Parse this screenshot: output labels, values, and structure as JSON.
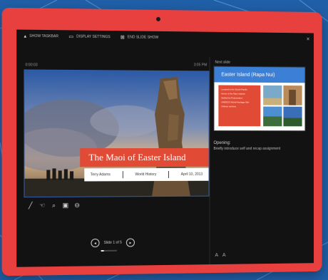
{
  "toolbar": {
    "items": [
      {
        "label": "SHOW TASKBAR",
        "icon": "taskbar-icon"
      },
      {
        "label": "DISPLAY SETTINGS",
        "icon": "display-icon"
      },
      {
        "label": "END SLIDE SHOW",
        "icon": "end-show-icon"
      }
    ]
  },
  "presenter": {
    "timer": "0:00:03",
    "clock": "3:05 PM",
    "next_label": "Next slide"
  },
  "current_slide": {
    "title": "The Maoi of Easter Island",
    "presenter": "Terry Adams",
    "course": "World History",
    "date": "April 10, 2013"
  },
  "tools": [
    "pen-icon",
    "pointer-icon",
    "zoom-icon",
    "screen-icon",
    "more-icon"
  ],
  "navigation": {
    "slide_counter": "Slide 1 of 5",
    "progress": 0.2
  },
  "next_slide": {
    "title": "Easter Island (Rapa Nui)",
    "bullets": [
      "Located in the South Pacific",
      "Home of the Maoi statues",
      "Settled by Polynesians",
      "UNESCO World Heritage Site",
      "Chilean territory"
    ]
  },
  "notes": {
    "title": "Opening:",
    "text": "Briefly introduce self and recap assignment"
  },
  "colors": {
    "tablet_frame": "#e8403f",
    "background": "#1f5fa8",
    "accent_red": "#e14b35",
    "accent_blue": "#3b7fd6"
  }
}
